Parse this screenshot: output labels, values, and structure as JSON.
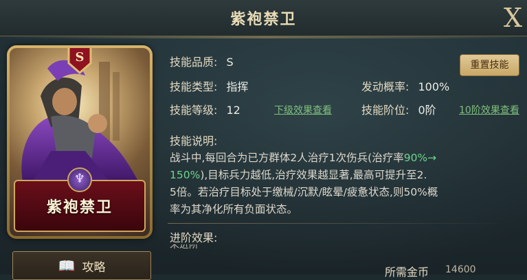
{
  "header": {
    "title": "紫袍禁卫",
    "close_label": "X"
  },
  "card": {
    "name": "紫袍禁卫",
    "grade": "S"
  },
  "guide_button": {
    "label": "攻略"
  },
  "skill": {
    "quality_label": "技能品质:",
    "quality_value": "S",
    "type_label": "技能类型:",
    "type_value": "指挥",
    "level_label": "技能等级:",
    "level_value": "12",
    "lower_effect_link": "下级效果查看",
    "trigger_label": "发动概率:",
    "trigger_value": "100%",
    "stage_label": "技能阶位:",
    "stage_value": "0阶",
    "stage10_link": "10阶效果查看",
    "reset_label": "重置技能"
  },
  "description": {
    "heading": "技能说明:",
    "part1": "战斗中,每回合为已方群体2人治疗1次伤兵(治疗率",
    "highlight1": "90%→",
    "highlight2": "150%",
    "part2": "),目标兵力越低,治疗效果越显著,最高可提升至2.",
    "line3": "5倍。若治疗目标处于缴械/沉默/眩晕/疲惫状态,则50%概",
    "line4": "率为其净化所有负面状态。"
  },
  "advanced": {
    "heading": "进阶效果:",
    "partial": "未进阶"
  },
  "cost": {
    "label": "所需金币",
    "value": "14600"
  },
  "colors": {
    "accent_green": "#6fd48a",
    "gold": "#d0a85a",
    "card_red": "#6a0f1a"
  }
}
